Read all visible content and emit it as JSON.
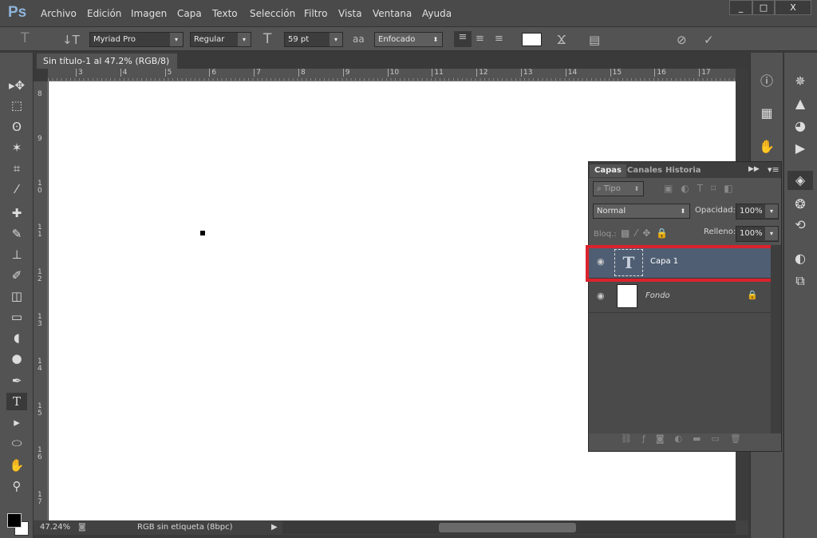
{
  "app": {
    "logo": "Ps",
    "menu": [
      "Archivo",
      "Edición",
      "Imagen",
      "Capa",
      "Texto",
      "Selección",
      "Filtro",
      "Vista",
      "Ventana",
      "Ayuda"
    ],
    "window_buttons": [
      "_",
      "□",
      "X"
    ]
  },
  "options": {
    "font_family": "Myriad Pro",
    "font_style": "Regular",
    "font_size": "59 pt",
    "antialias": "Enfocado",
    "antialias_icon": "aa",
    "color_swatch": "#ffffff"
  },
  "document": {
    "tab_title": "Sin título-1 al 47.2% (RGB/8)",
    "close": "×"
  },
  "rulers": {
    "horizontal": [
      "3",
      "4",
      "5",
      "6",
      "7",
      "8",
      "9",
      "10",
      "11",
      "12",
      "13",
      "14",
      "15",
      "16",
      "17"
    ],
    "vertical": [
      "8",
      "9",
      "1 0",
      "1 1",
      "1 2",
      "1 3",
      "1 4",
      "1 5",
      "1 6",
      "1 7"
    ]
  },
  "status": {
    "zoom": "47.24%",
    "profile": "RGB sin etiqueta (8bpc)"
  },
  "layers_panel": {
    "tabs": [
      "Capas",
      "Canales",
      "Historia"
    ],
    "filter": "Tipo",
    "blend_mode": "Normal",
    "opacity_label": "Opacidad:",
    "opacity": "100%",
    "lock_label": "Bloq.:",
    "fill_label": "Relleno:",
    "fill": "100%",
    "layers": [
      {
        "name": "Capa 1",
        "type": "text",
        "selected": true,
        "highlight": "#d9232d"
      },
      {
        "name": "Fondo",
        "type": "background",
        "locked": true
      }
    ]
  },
  "colors": {
    "foreground": "#000000",
    "background": "#ffffff",
    "selection": "#4f5e73"
  }
}
